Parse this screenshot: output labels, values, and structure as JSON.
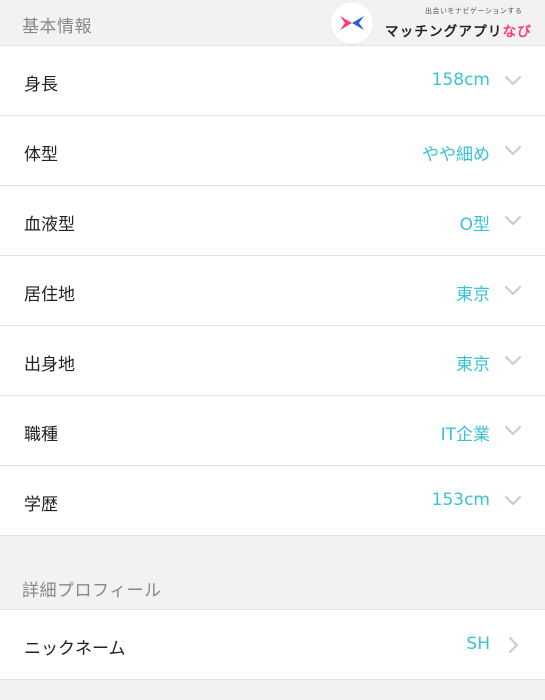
{
  "basic_section": {
    "title": "基本情報"
  },
  "logo": {
    "tagline": "出会いをナビゲーションする",
    "name_main": "マッチングアプリ",
    "name_accent": "なび",
    "icon": "butterfly-logo-icon",
    "colors": {
      "pink": "#ff3b6b",
      "blue": "#2b5fd9"
    }
  },
  "basic_rows": [
    {
      "label": "身長",
      "value": "158cm"
    },
    {
      "label": "体型",
      "value": "やや細め"
    },
    {
      "label": "血液型",
      "value": "O型"
    },
    {
      "label": "居住地",
      "value": "東京"
    },
    {
      "label": "出身地",
      "value": "東京"
    },
    {
      "label": "職種",
      "value": "IT企業"
    },
    {
      "label": "学歴",
      "value": "153cm"
    }
  ],
  "detail_section": {
    "title": "詳細プロフィール"
  },
  "detail_rows": [
    {
      "label": "ニックネーム",
      "value": "SH"
    }
  ],
  "icons": {
    "row_dropdown": "chevron-down-icon",
    "row_link": "chevron-right-icon"
  },
  "colors": {
    "value_text": "#38c3d3",
    "label_text": "#222222",
    "section_title": "#888888",
    "background": "#f2f2f2",
    "row_background": "#ffffff",
    "chevron": "#cccccc"
  }
}
